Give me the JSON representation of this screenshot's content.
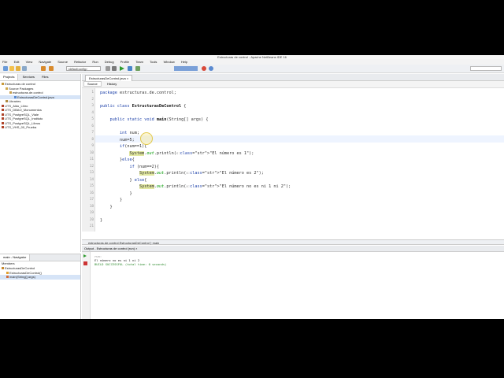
{
  "window": {
    "title": "Estructuras de control - Apache NetBeans IDE 16"
  },
  "menu": [
    "File",
    "Edit",
    "View",
    "Navigate",
    "Source",
    "Refactor",
    "Run",
    "Debug",
    "Profile",
    "Team",
    "Tools",
    "Window",
    "Help"
  ],
  "toolbar": {
    "config": "<default config>",
    "memory": ""
  },
  "projects_panel": {
    "tabs": [
      "Projects",
      "Services",
      "Files"
    ],
    "tree": [
      "Estructuras de control",
      "Source Packages",
      "estructuras.de.control",
      "EstructurasDeControl.java",
      "Libraries",
      "UTS_Aldo_Libro",
      "UTS_DBAO_Monumentos",
      "UTS_PostgreSQL_Viale",
      "UTS_PostgreSQL_Instituto",
      "UTS_PostgreSQL_Libros",
      "UTS_VHS_00_Prueba"
    ]
  },
  "navigator_panel": {
    "title": "main - Navigator",
    "members_label": "Members",
    "items": [
      "EstructurasDeControl",
      "EstructurasDeControl()",
      "main(String[] args)"
    ]
  },
  "editor": {
    "tab": "EstructurasDeControl.java",
    "subtabs": [
      "Source",
      "History"
    ],
    "lines": [
      "package estructuras.de.control;",
      "",
      "public class EstructurasDeControl {",
      "",
      "    public static void main(String[] args) {",
      "",
      "        int num;",
      "        num=5;",
      "        if(num==1){",
      "            System.out.println(s:\"El número es 1\");",
      "        }else{",
      "            if (num==2){",
      "                System.out.println(x:\"El número es 2\");",
      "            } else{",
      "                System.out.println(x:\"El número no es ni 1 ni 2\");",
      "            }",
      "        }",
      "    }",
      "",
      "}",
      ""
    ],
    "line_numbers": [
      "1",
      "2",
      "3",
      "4",
      "5",
      "6",
      "7",
      "8",
      "9",
      "10",
      "11",
      "12",
      "13",
      "14",
      "15",
      "16",
      "17",
      "18",
      "19",
      "20",
      "21"
    ]
  },
  "breadcrumb": {
    "path": "estructuras.de.control.EstructurasDeControl",
    "method": "main"
  },
  "output": {
    "title": "Output - Estructuras de control (run)",
    "lines": [
      "run:",
      "El número no es ni 1 ni 2",
      "BUILD SUCCESSFUL (total time: 0 seconds)"
    ]
  },
  "colors": {
    "keyword": "#1b3fa8",
    "string": "#ce7b00",
    "success": "#2e8b2e"
  }
}
